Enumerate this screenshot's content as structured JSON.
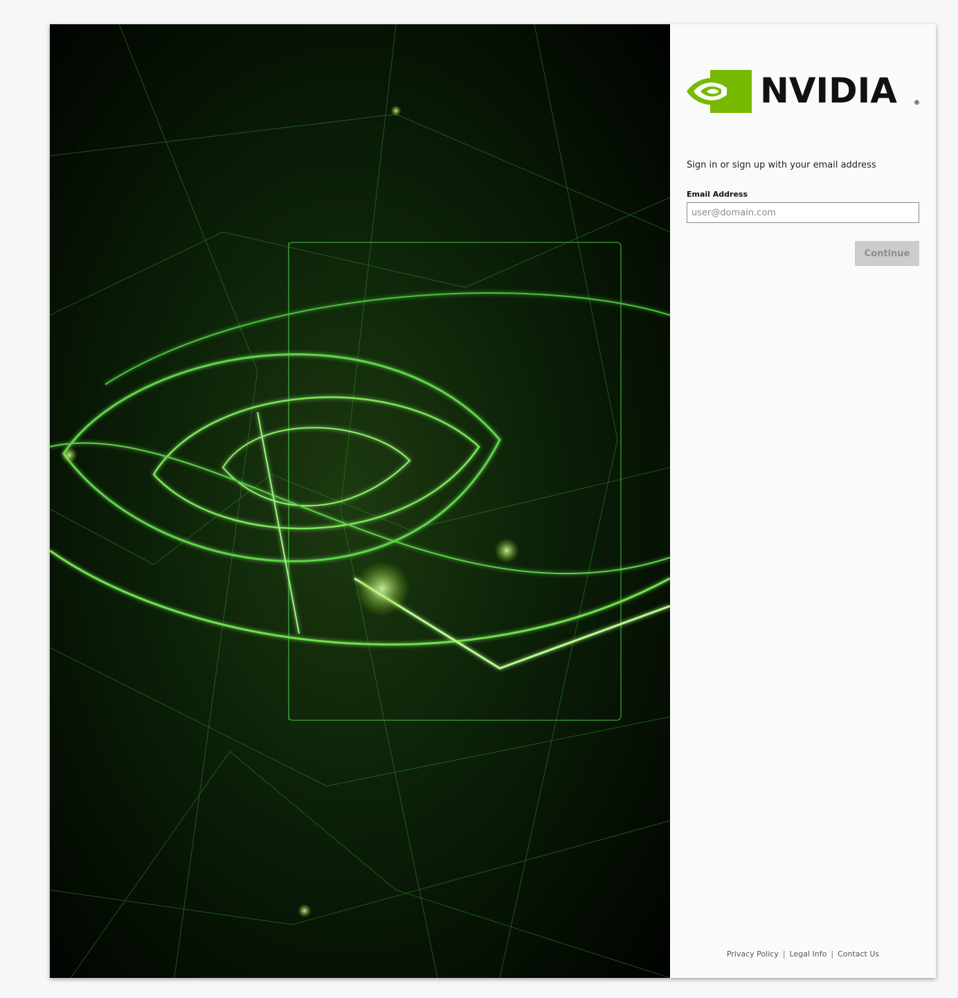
{
  "brand": {
    "wordmark": "NVIDIA",
    "registered": "®",
    "accent_color": "#76b900",
    "logo_icon": "nvidia-eye-logo-icon"
  },
  "signin": {
    "prompt": "Sign in or sign up with your email address",
    "email_label": "Email Address",
    "email_placeholder": "user@domain.com",
    "email_value": "",
    "continue_label": "Continue",
    "continue_disabled": true
  },
  "footer": {
    "links": [
      "Privacy Policy",
      "Legal Info",
      "Contact Us"
    ],
    "separator": "|"
  },
  "hero": {
    "image_icon": "green-neural-network-eye-artwork",
    "colors": [
      "#000000",
      "#76b900",
      "#39ff4a"
    ]
  }
}
